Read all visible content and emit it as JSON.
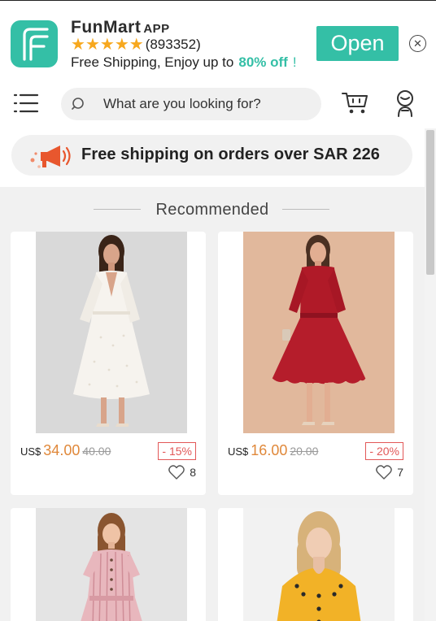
{
  "banner": {
    "app_name": "FunMart",
    "app_suffix": "APP",
    "rating_count": "(893352)",
    "stars": 5,
    "promo_text": "Free Shipping, Enjoy up to",
    "promo_highlight": "80% off",
    "promo_end": "!",
    "open_label": "Open",
    "close_icon": "close-icon",
    "accent_color": "#34bfa6",
    "star_color": "#f7a81e"
  },
  "nav": {
    "menu_icon": "menu-icon",
    "search_placeholder": "What are you looking for?",
    "cart_icon": "cart-icon",
    "user_icon": "user-icon"
  },
  "shipping_notice": {
    "text": "Free shipping on orders over SAR 226",
    "icon": "megaphone-icon"
  },
  "section": {
    "title": "Recommended"
  },
  "products": [
    {
      "currency": "US$",
      "price": "34.00",
      "old_price": "40.00",
      "discount": "- 15%",
      "likes": "8",
      "image": "woman in white long-sleeve midi dress on grey background"
    },
    {
      "currency": "US$",
      "price": "16.00",
      "old_price": "20.00",
      "discount": "- 20%",
      "likes": "7",
      "image": "woman in red scalloped belted dress on tan background"
    },
    {
      "image": "girl in pink striped dress"
    },
    {
      "image": "woman in mustard yellow buttoned top"
    }
  ],
  "colors": {
    "price": "#e0883a",
    "discount": "#e25858"
  }
}
